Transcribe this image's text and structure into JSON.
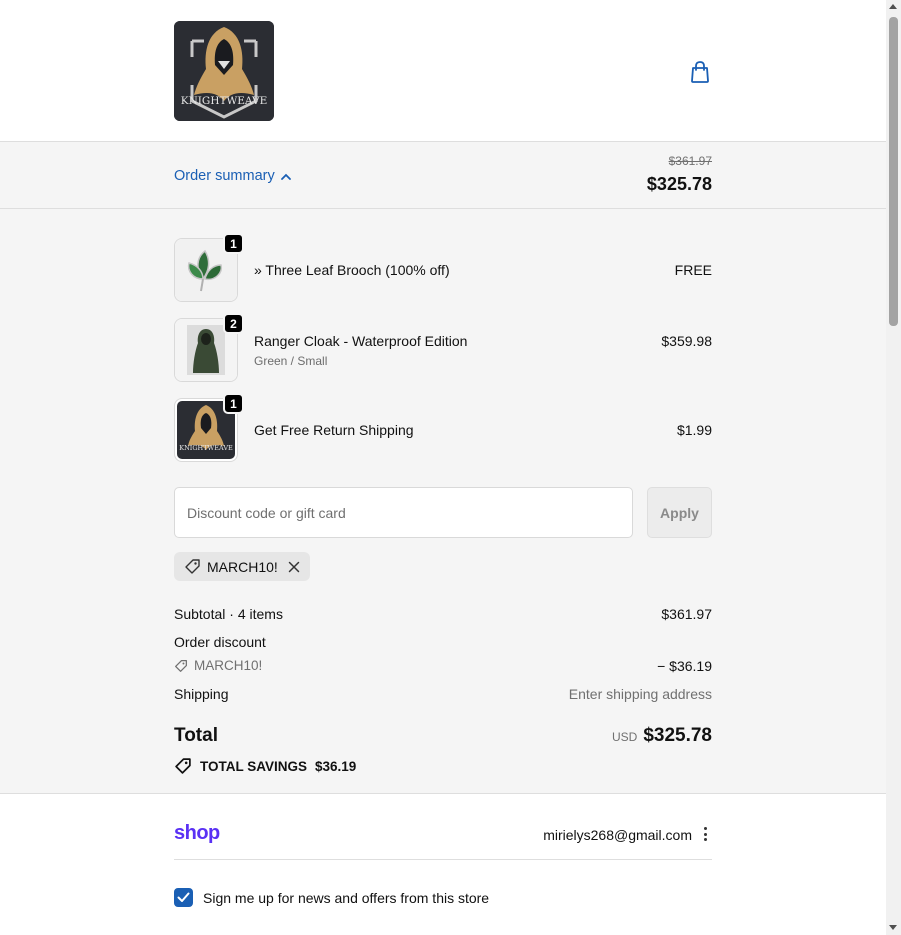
{
  "header": {
    "logo_text": "KNIGHTWEAVE",
    "cart_icon": "shopping-bag-icon"
  },
  "summary": {
    "toggle_label": "Order summary",
    "original_price": "$361.97",
    "current_price": "$325.78"
  },
  "items": [
    {
      "name": "» Three Leaf Brooch (100% off)",
      "variant": "",
      "qty": "1",
      "price": "FREE"
    },
    {
      "name": "Ranger Cloak - Waterproof Edition",
      "variant": "Green / Small",
      "qty": "2",
      "price": "$359.98"
    },
    {
      "name": "Get Free Return Shipping",
      "variant": "",
      "qty": "1",
      "price": "$1.99"
    }
  ],
  "discount": {
    "placeholder": "Discount code or gift card",
    "apply_label": "Apply",
    "applied_code": "MARCH10!"
  },
  "totals": {
    "subtotal_label": "Subtotal · 4 items",
    "subtotal_value": "$361.97",
    "order_discount_label": "Order discount",
    "order_discount_code": "MARCH10!",
    "order_discount_value": "− $36.19",
    "shipping_label": "Shipping",
    "shipping_value": "Enter shipping address",
    "total_label": "Total",
    "currency": "USD",
    "total_value": "$325.78",
    "savings_label": "TOTAL SAVINGS",
    "savings_value": "$36.19"
  },
  "contact": {
    "shop_brand": "shop",
    "email": "mirielys268@gmail.com",
    "newsletter_label": "Sign me up for news and offers from this store",
    "newsletter_checked": true
  },
  "colors": {
    "accent": "#1a5fb4",
    "shop_brand": "#5a31f4",
    "panel": "#f5f5f5"
  }
}
